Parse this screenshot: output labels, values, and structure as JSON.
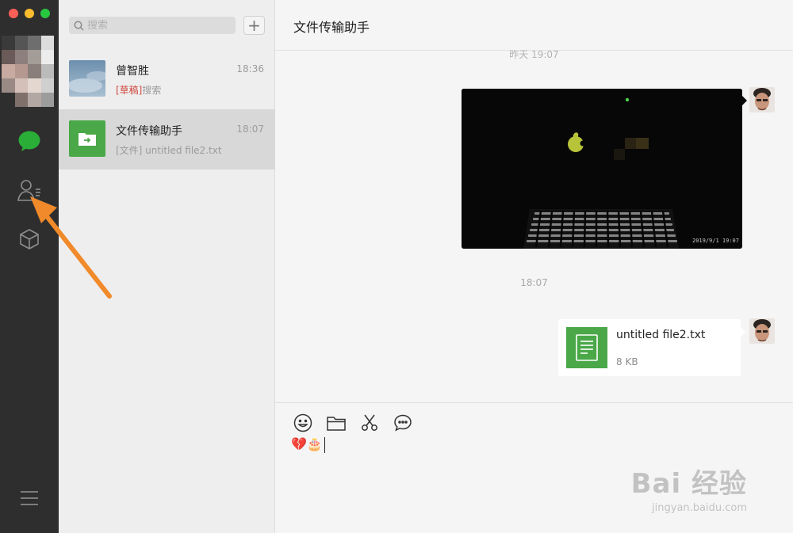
{
  "sidebar": {
    "icons": [
      "chat-icon",
      "contacts-icon",
      "mini-program-icon",
      "menu-icon"
    ],
    "accent_color": "#2aae37"
  },
  "chat_list": {
    "search_placeholder": "搜索",
    "add_label": "+",
    "items": [
      {
        "name": "曾智胜",
        "time": "18:36",
        "draft_tag": "[草稿]",
        "preview": "搜索",
        "active": false
      },
      {
        "name": "文件传输助手",
        "time": "18:07",
        "draft_tag": "",
        "preview": "[文件] untitled file2.txt",
        "active": true
      }
    ]
  },
  "chat": {
    "title": "文件传输助手",
    "timestamp_top": "昨天 19:07",
    "timestamp_mid": "18:07",
    "photo_stamp": "2019/9/1  19:07",
    "file": {
      "name": "untitled file2.txt",
      "size": "8 KB",
      "color": "#4aa848"
    }
  },
  "composer": {
    "tools": [
      "emoji-icon",
      "folder-icon",
      "scissors-icon",
      "chat-bubble-icon"
    ],
    "input_text": "💔🎂"
  },
  "watermark": {
    "main": "Bai 经验",
    "sub": "jingyan.baidu.com"
  },
  "annotation": {
    "arrow_color": "#f08a2a"
  }
}
